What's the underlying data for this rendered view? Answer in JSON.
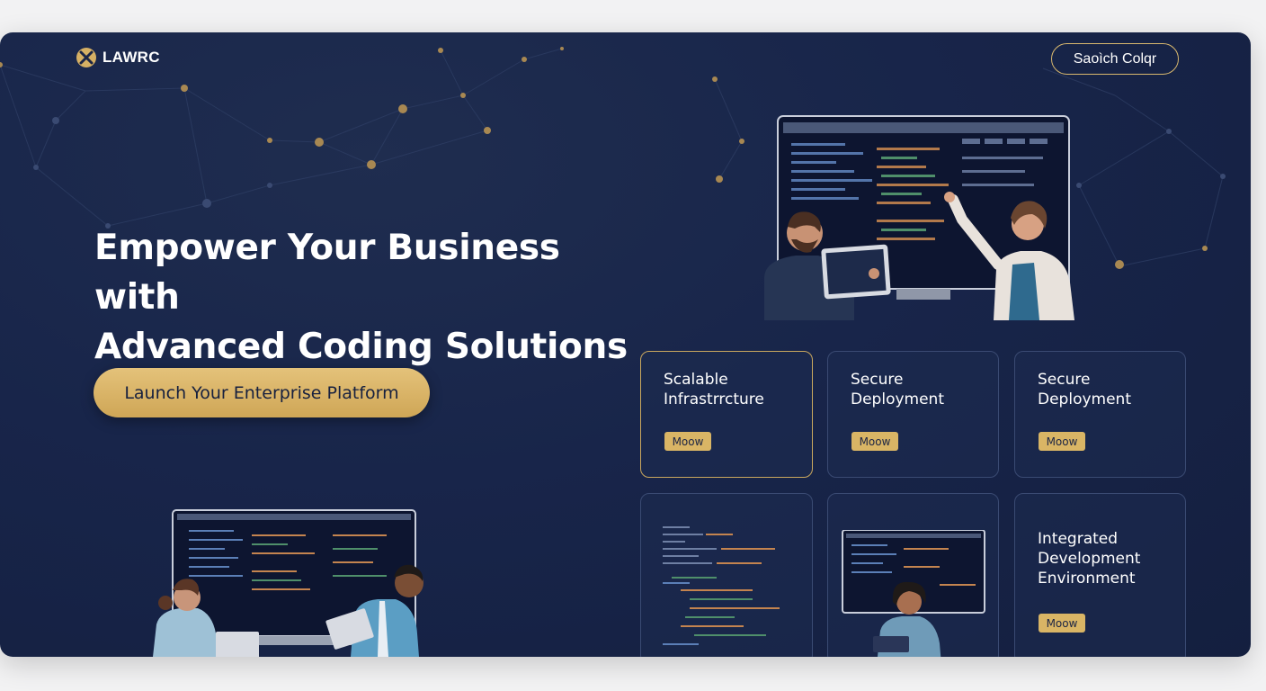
{
  "brand": {
    "name": "LAWRC"
  },
  "header": {
    "search_label": "Saoìch Colqr"
  },
  "hero": {
    "title_line1": "Empower Your Business with",
    "title_line2": "Advanced Coding Solutions",
    "cta_label": "Launch Your Enterprise Platform"
  },
  "cards": [
    {
      "title": "Scalable\nInfrastrrcture",
      "button": "Moow"
    },
    {
      "title": "Secure\nDeployment",
      "button": "Moow"
    },
    {
      "title": "Secure\nDeployment",
      "button": "Moow"
    },
    {
      "title": "Integrated\nDevelopment\nEnvironment",
      "button": "Moow"
    }
  ],
  "colors": {
    "background": "#18254a",
    "accent_gold": "#d9b565",
    "card_border": "#3a4a72",
    "text": "#ffffff"
  },
  "icons": [
    "logo-icon"
  ]
}
